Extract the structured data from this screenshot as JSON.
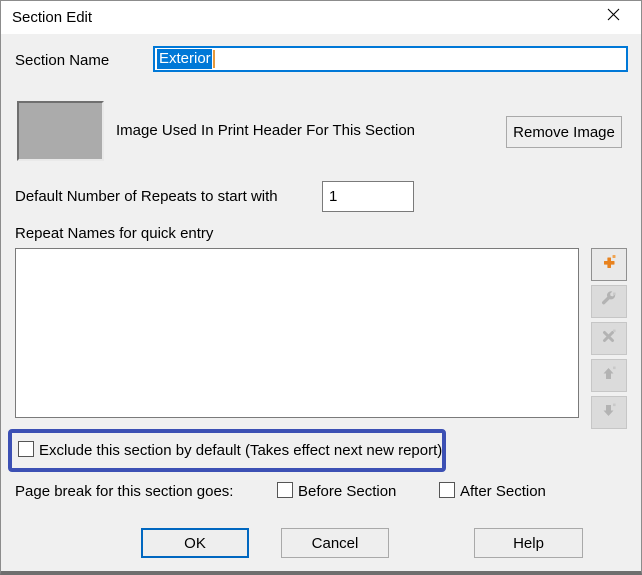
{
  "window": {
    "title": "Section Edit",
    "close_icon": "close-icon"
  },
  "section_name": {
    "label": "Section Name",
    "value": "Exterior",
    "selected": true
  },
  "image_row": {
    "label": "Image Used In Print Header For This Section",
    "remove_button_label": "Remove Image",
    "placeholder_icon": "image-placeholder"
  },
  "repeats": {
    "label": "Default Number of Repeats to start with",
    "value": "1"
  },
  "repeat_names": {
    "label": "Repeat Names for quick entry",
    "items": []
  },
  "list_buttons": [
    {
      "name": "add-repeat",
      "icon": "plus-icon",
      "enabled": true
    },
    {
      "name": "edit-repeat",
      "icon": "wrench-icon",
      "enabled": false
    },
    {
      "name": "delete-repeat",
      "icon": "delete-x-icon",
      "enabled": false
    },
    {
      "name": "move-up",
      "icon": "arrow-up-icon",
      "enabled": false
    },
    {
      "name": "move-down",
      "icon": "arrow-down-icon",
      "enabled": false
    }
  ],
  "exclude_section": {
    "label": "Exclude this section by default (Takes effect next new report)",
    "checked": false,
    "highlighted": true
  },
  "page_break": {
    "label": "Page break for this section goes:",
    "before": {
      "label": "Before Section",
      "checked": false
    },
    "after": {
      "label": "After Section",
      "checked": false
    }
  },
  "footer": {
    "ok_label": "OK",
    "cancel_label": "Cancel",
    "help_label": "Help"
  },
  "colors": {
    "accent_blue": "#0078d7",
    "caret_orange": "#e89a3c",
    "annotation_blue": "#3c50b4",
    "ok_border": "#0067c0",
    "plus_orange": "#e8821e",
    "disabled_icon": "#b3b3b3",
    "dialog_bg": "#f0f0f0"
  }
}
